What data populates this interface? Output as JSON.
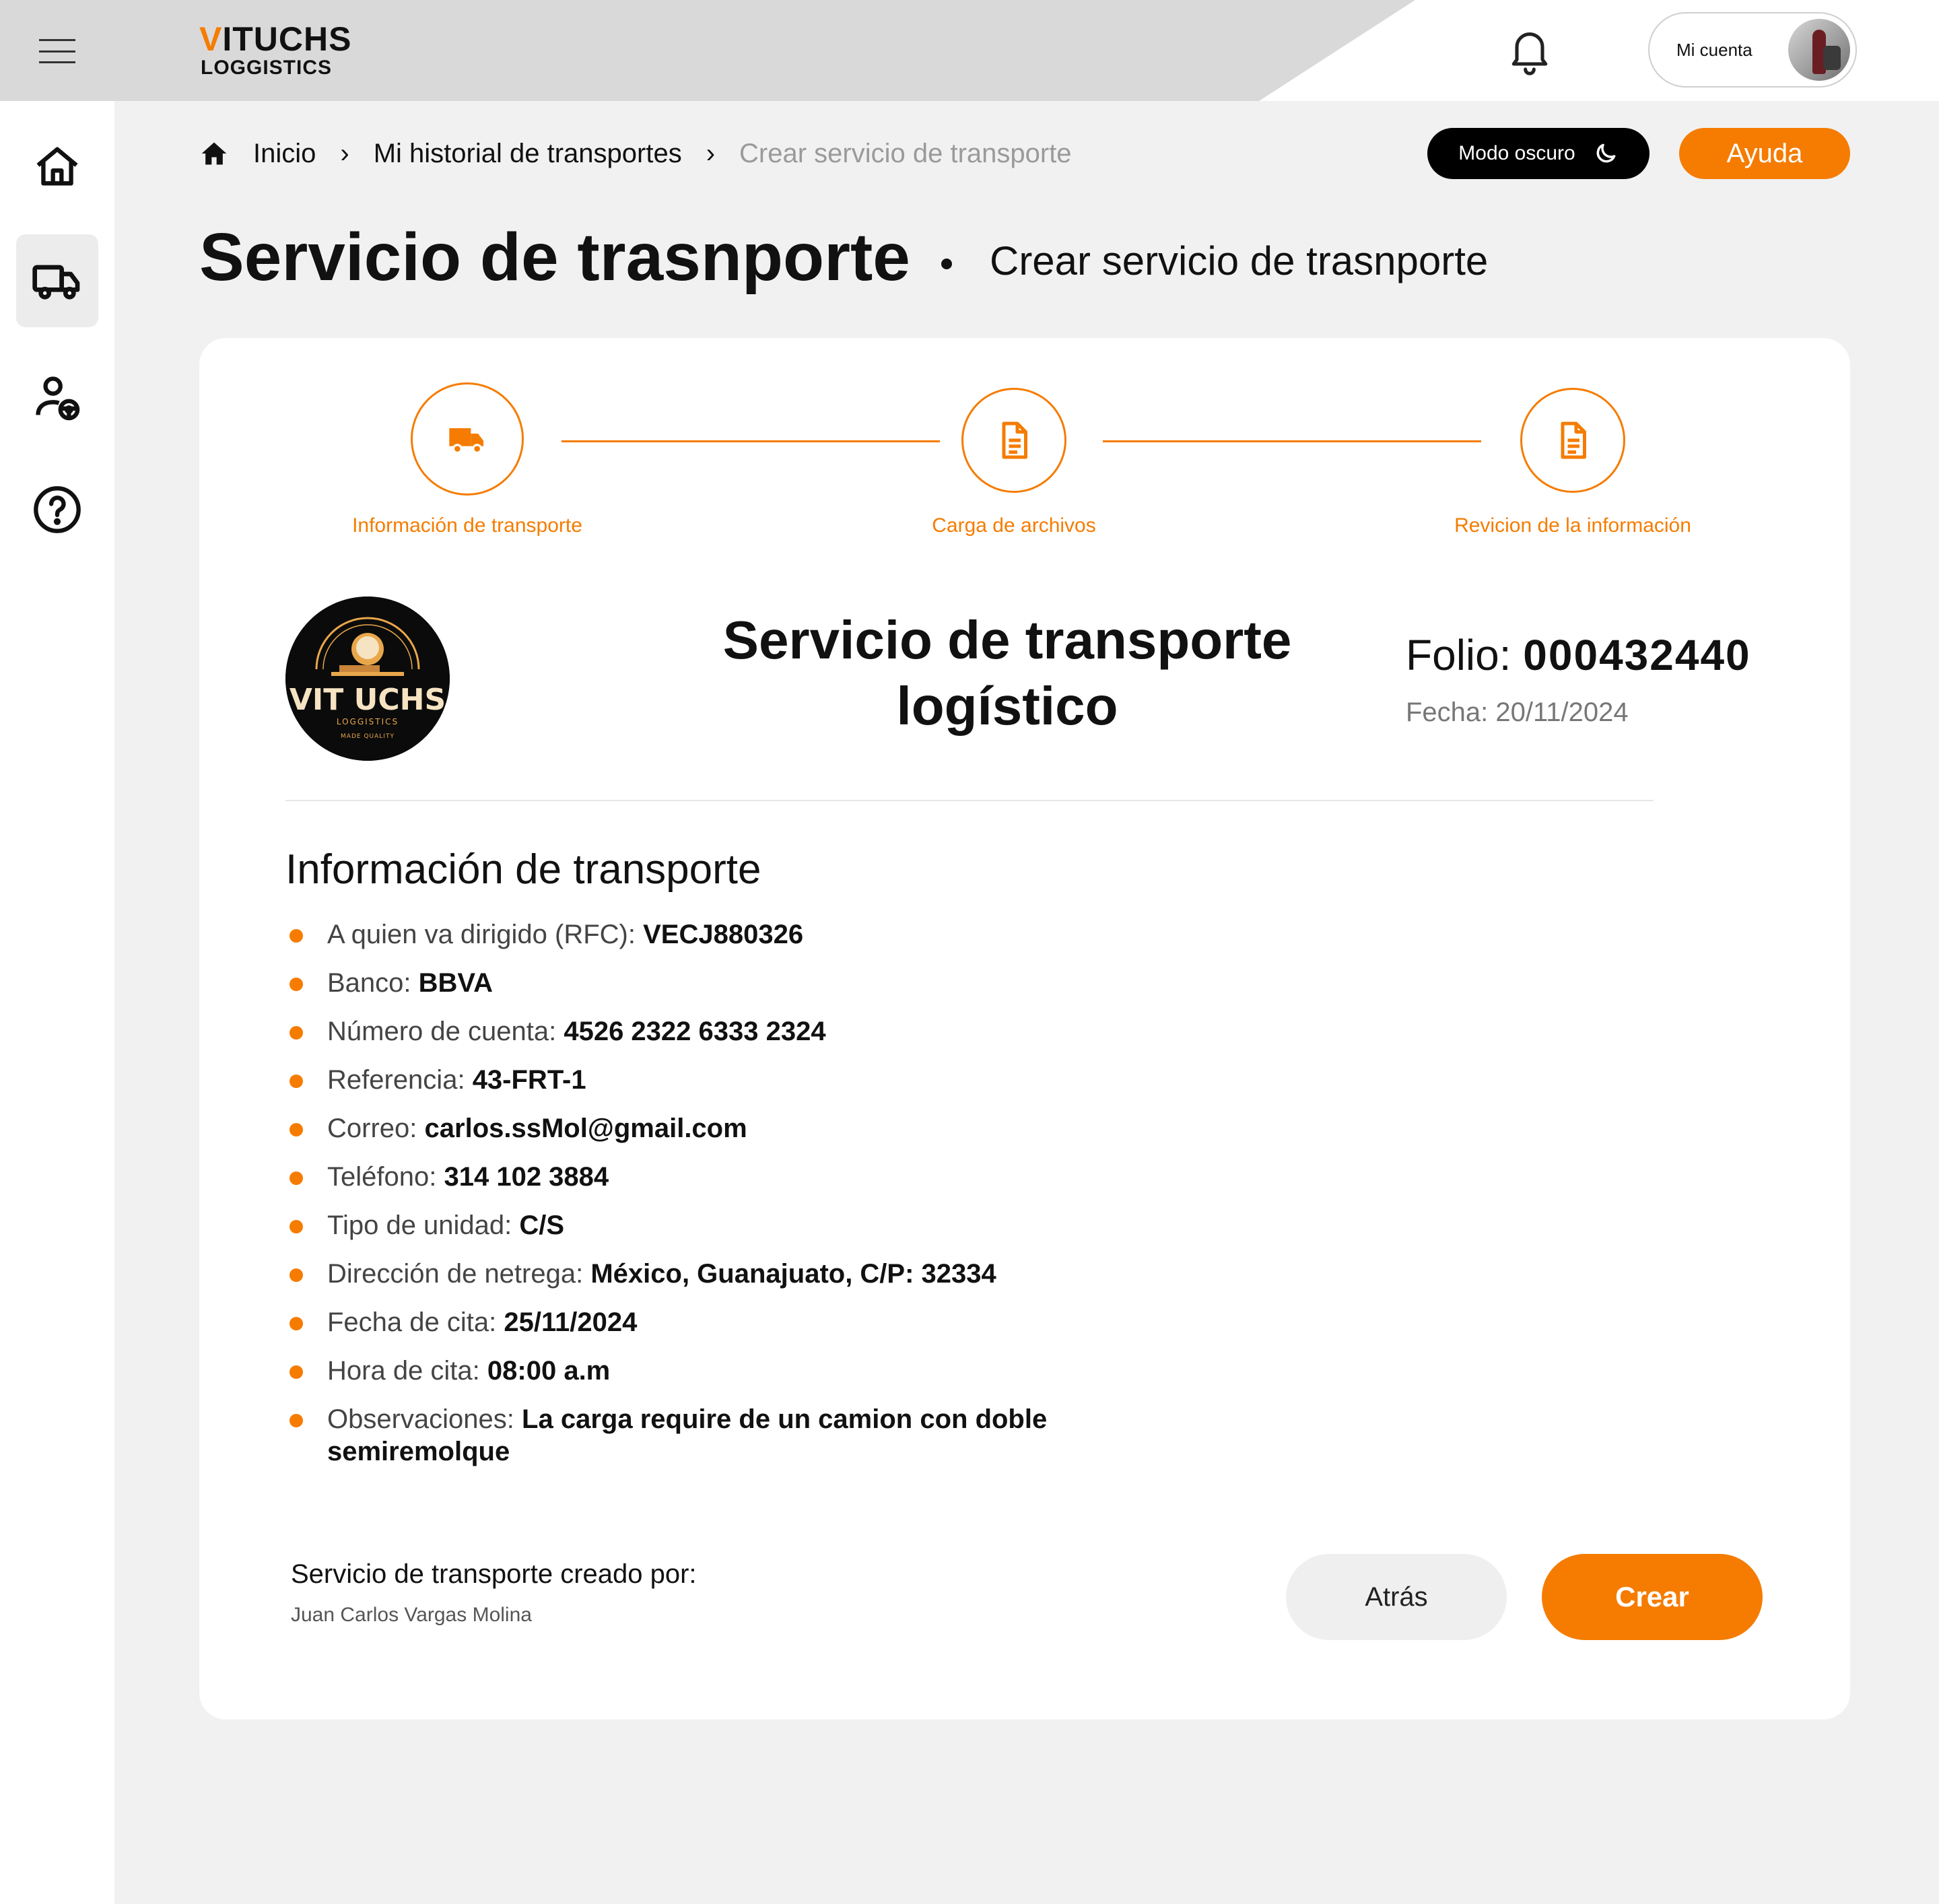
{
  "brand": {
    "name_prefix": "V",
    "name_rest": "ITUCHS",
    "subtitle": "LOGGISTICS",
    "accent": "#f57c00"
  },
  "header": {
    "account_label": "Mi cuenta",
    "icons": [
      "menu-icon",
      "bell-icon"
    ]
  },
  "sidebar": {
    "items": [
      {
        "icon": "home-icon",
        "active": false
      },
      {
        "icon": "truck-icon",
        "active": true
      },
      {
        "icon": "user-driver-icon",
        "active": false
      },
      {
        "icon": "help-icon",
        "active": false
      }
    ]
  },
  "breadcrumb": {
    "items": [
      "Inicio",
      "Mi historial de transportes",
      "Crear servicio de transporte"
    ],
    "separator": "›"
  },
  "toolbar": {
    "dark_mode_label": "Modo oscuro",
    "help_label": "Ayuda"
  },
  "page": {
    "title": "Servicio de trasnporte",
    "subtitle": "Crear servicio de trasnporte"
  },
  "steps": [
    {
      "label": "Información de transporte",
      "icon": "truck-icon"
    },
    {
      "label": "Carga de archivos",
      "icon": "document-icon"
    },
    {
      "label": "Revicion de la información",
      "icon": "document-icon"
    }
  ],
  "document": {
    "logo_text": "VIT UCHS",
    "logo_sub": "LOGGISTICS",
    "logo_motto": "MADE QUALITY",
    "title_line1": "Servicio de transporte",
    "title_line2": "logístico",
    "folio_label": "Folio:",
    "folio_value": "000432440",
    "fecha": "Fecha: 20/11/2024"
  },
  "info": {
    "section_title": "Información de transporte",
    "fields": [
      {
        "label": "A quien va dirigido (RFC):",
        "value": "VECJ880326"
      },
      {
        "label": "Banco:",
        "value": "BBVA"
      },
      {
        "label": "Número de cuenta:",
        "value": "4526 2322 6333 2324"
      },
      {
        "label": "Referencia:",
        "value": "43-FRT-1"
      },
      {
        "label": "Correo:",
        "value": "carlos.ssMol@gmail.com"
      },
      {
        "label": "Teléfono:",
        "value": "314 102 3884"
      },
      {
        "label": "Tipo de unidad:",
        "value": "C/S"
      },
      {
        "label": "Dirección de netrega:",
        "value": "México,  Guanajuato, C/P: 32334"
      },
      {
        "label": "Fecha de cita:",
        "value": "25/11/2024"
      },
      {
        "label": "Hora de cita:",
        "value": "08:00 a.m"
      },
      {
        "label": "Observaciones:",
        "value": "La carga require de un camion con doble semiremolque"
      }
    ]
  },
  "footer": {
    "created_label": "Servicio de transporte creado por:",
    "created_name": "Juan Carlos Vargas Molina",
    "back_label": "Atrás",
    "create_label": "Crear"
  }
}
